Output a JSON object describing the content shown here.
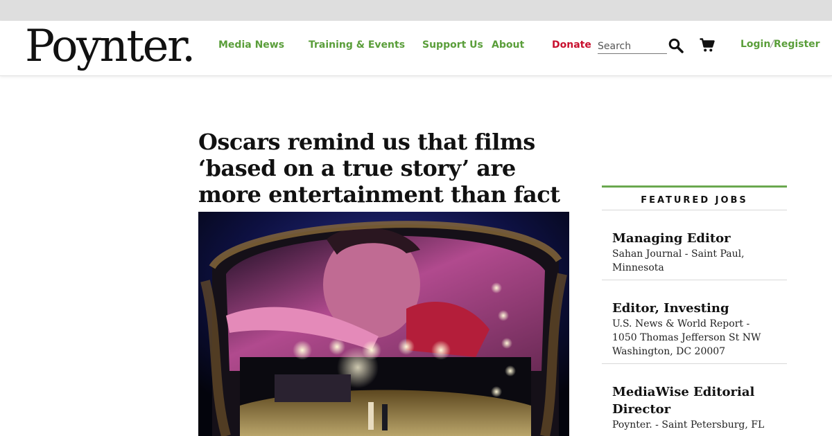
{
  "header": {
    "logo": "Poynter.",
    "nav": [
      "Media News",
      "Training & Events",
      "Support Us",
      "About"
    ],
    "donate": "Donate",
    "search_placeholder": "Search",
    "login": "Login",
    "login_separator": "/",
    "register": "Register"
  },
  "article": {
    "headline": "Oscars remind us that films ‘based on a true story’ are more entertainment than fact"
  },
  "featured_jobs": {
    "heading": "FEATURED JOBS",
    "jobs": [
      {
        "title": "Managing Editor",
        "meta": "Sahan Journal - Saint Paul, Minnesota"
      },
      {
        "title": "Editor, Investing",
        "meta": "U.S. News & World Report - 1050 Thomas Jefferson St NW Washington, DC 20007"
      },
      {
        "title": "MediaWise Editorial Director",
        "meta": "Poynter. - Saint Petersburg, FL"
      }
    ]
  },
  "icons": {
    "search": "search-icon",
    "cart": "shopping-cart-icon"
  },
  "colors": {
    "nav_green": "#5a9e3a",
    "donate_red": "#c8102e",
    "jobs_rule": "#6aa84f",
    "text": "#111111"
  }
}
